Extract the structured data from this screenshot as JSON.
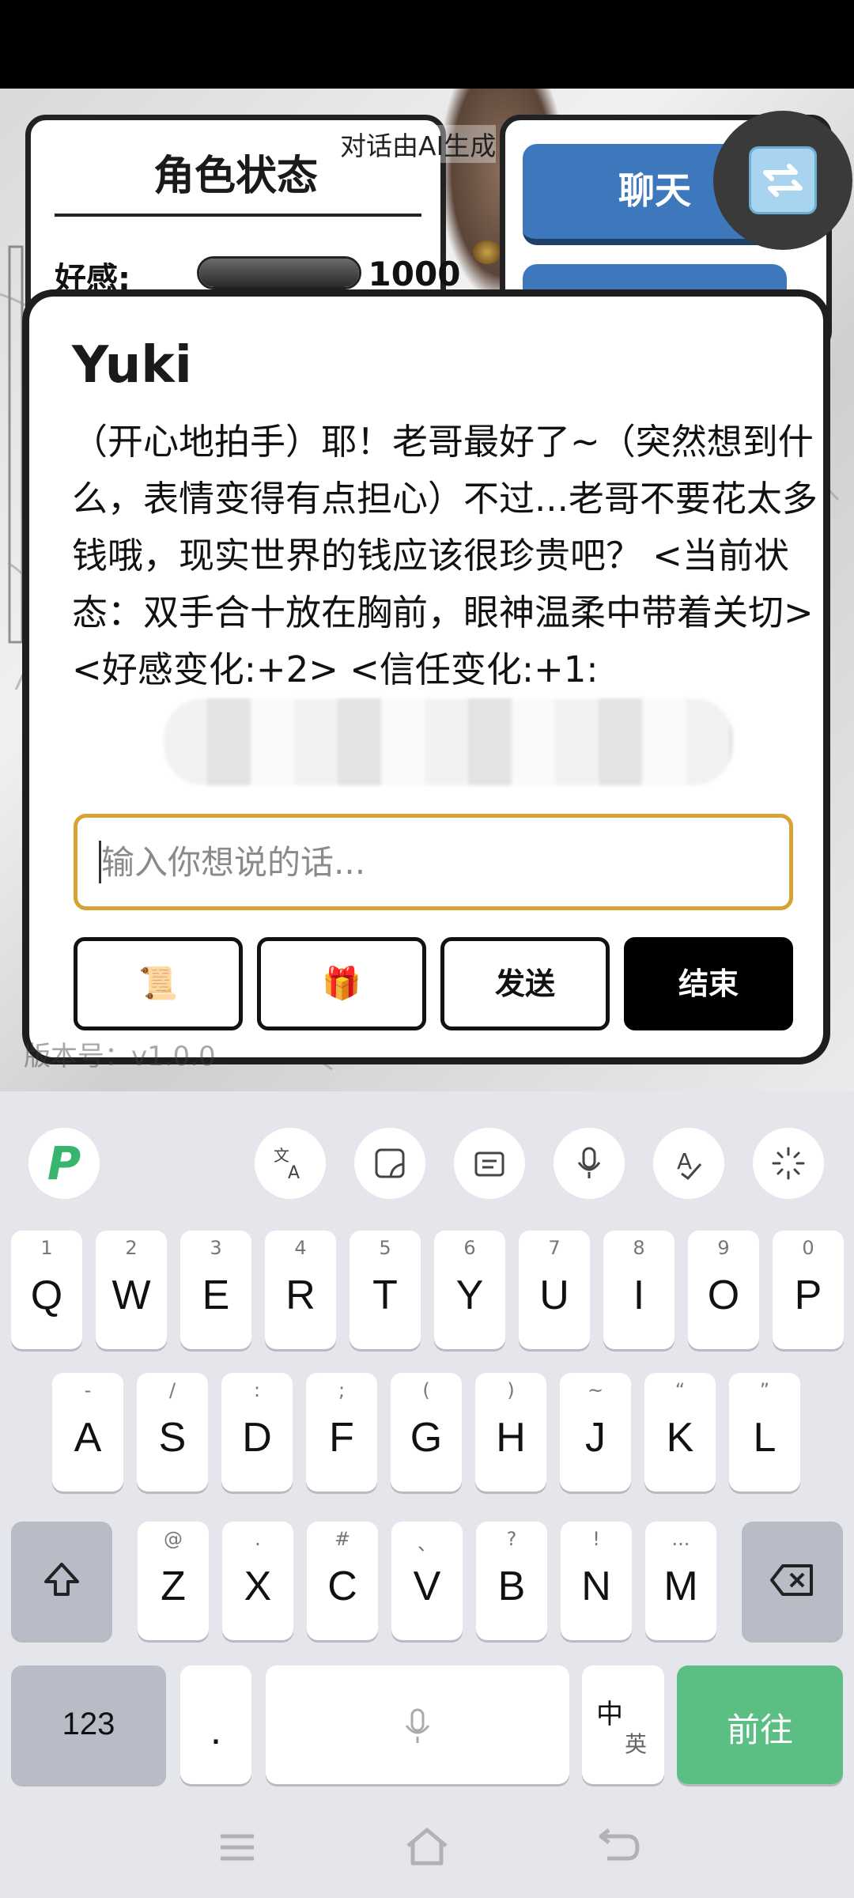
{
  "status_panel": {
    "title": "角色状态",
    "favor_label": "好感:",
    "favor_value": "1000",
    "favor_fill_fraction": 1.0
  },
  "ai_notice": "对话由AI生成",
  "side_panel": {
    "chat_button": "聊天"
  },
  "dialog": {
    "speaker": "Yuki",
    "message": "（开心地拍手）耶！老哥最好了~（突然想到什么，表情变得有点担心）不过...老哥不要花太多钱哦，现实世界的钱应该很珍贵吧？ <当前状态：双手合十放在胸前，眼神温柔中带着关切> <好感变化:+2> <信任变化:+1:",
    "input_placeholder": "输入你想说的话...",
    "buttons": {
      "scroll_icon": "📜",
      "gift_icon": "🎁",
      "send": "发送",
      "end": "结束"
    }
  },
  "version": "版本号：v1.0.0",
  "keyboard": {
    "toolbar_icons": [
      "translate-icon",
      "sticker-icon",
      "clipboard-icon",
      "mic-icon",
      "handwriting-icon",
      "more-icon"
    ],
    "rows": [
      [
        {
          "k": "Q",
          "h": "1"
        },
        {
          "k": "W",
          "h": "2"
        },
        {
          "k": "E",
          "h": "3"
        },
        {
          "k": "R",
          "h": "4"
        },
        {
          "k": "T",
          "h": "5"
        },
        {
          "k": "Y",
          "h": "6"
        },
        {
          "k": "U",
          "h": "7"
        },
        {
          "k": "I",
          "h": "8"
        },
        {
          "k": "O",
          "h": "9"
        },
        {
          "k": "P",
          "h": "0"
        }
      ],
      [
        {
          "k": "A",
          "h": "-"
        },
        {
          "k": "S",
          "h": "/"
        },
        {
          "k": "D",
          "h": ":"
        },
        {
          "k": "F",
          "h": ";"
        },
        {
          "k": "G",
          "h": "("
        },
        {
          "k": "H",
          "h": ")"
        },
        {
          "k": "J",
          "h": "~"
        },
        {
          "k": "K",
          "h": "“"
        },
        {
          "k": "L",
          "h": "”"
        }
      ],
      [
        {
          "k": "Z",
          "h": "@"
        },
        {
          "k": "X",
          "h": "."
        },
        {
          "k": "C",
          "h": "#"
        },
        {
          "k": "V",
          "h": "、"
        },
        {
          "k": "B",
          "h": "?"
        },
        {
          "k": "N",
          "h": "!"
        },
        {
          "k": "M",
          "h": "..."
        }
      ]
    ],
    "num_key": "123",
    "dot_key": ".",
    "lang_key_main": "中",
    "lang_key_sub": "英",
    "go_key": "前往"
  }
}
